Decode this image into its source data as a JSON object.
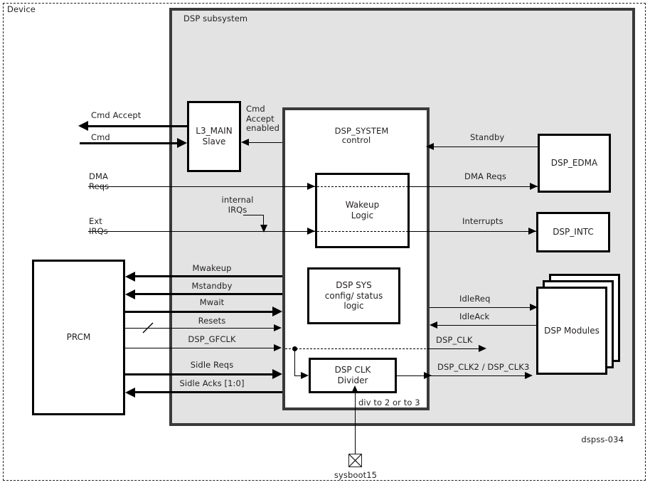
{
  "figure": {
    "id_label": "dspss-034",
    "device_label": "Device",
    "subsystem_label": "DSP subsystem"
  },
  "blocks": {
    "l3_main_slave": "L3_MAIN\nSlave",
    "dsp_system_control": "DSP_SYSTEM\ncontrol",
    "wakeup_logic": "Wakeup\nLogic",
    "dsp_sys_config": "DSP SYS\nconfig/ status\nlogic",
    "dsp_clk_divider": "DSP CLK\nDivider",
    "prcm": "PRCM",
    "dsp_edma": "DSP_EDMA",
    "dsp_intc": "DSP_INTC",
    "dsp_modules": "DSP Modules"
  },
  "signals": {
    "cmd_accept": "Cmd Accept",
    "cmd": "Cmd",
    "cmd_accept_enabled": "Cmd\nAccept\nenabled",
    "dma_reqs_in": "DMA\nReqs",
    "internal_irqs": "internal\nIRQs",
    "ext_irqs": "Ext\nIRQs",
    "standby": "Standby",
    "dma_reqs_out": "DMA Reqs",
    "interrupts": "Interrupts",
    "mwakeup": "Mwakeup",
    "mstandby": "Mstandby",
    "mwait": "Mwait",
    "resets": "Resets",
    "dsp_gfclk": "DSP_GFCLK",
    "sidle_reqs": "Sidle Reqs",
    "sidle_acks": "Sidle Acks [1:0]",
    "idlereq": "IdleReq",
    "idleack": "IdleAck",
    "dsp_clk": "DSP_CLK",
    "dsp_clk23": "DSP_CLK2 / DSP_CLK3",
    "div_note": "div to 2 or to 3",
    "sysboot15": "sysboot15"
  },
  "colors": {
    "subsystem_fill": "#e3e3e3",
    "block_fill": "#ffffff",
    "line": "#000000",
    "container_border": "#3a3a3a",
    "text": "#231f20"
  }
}
